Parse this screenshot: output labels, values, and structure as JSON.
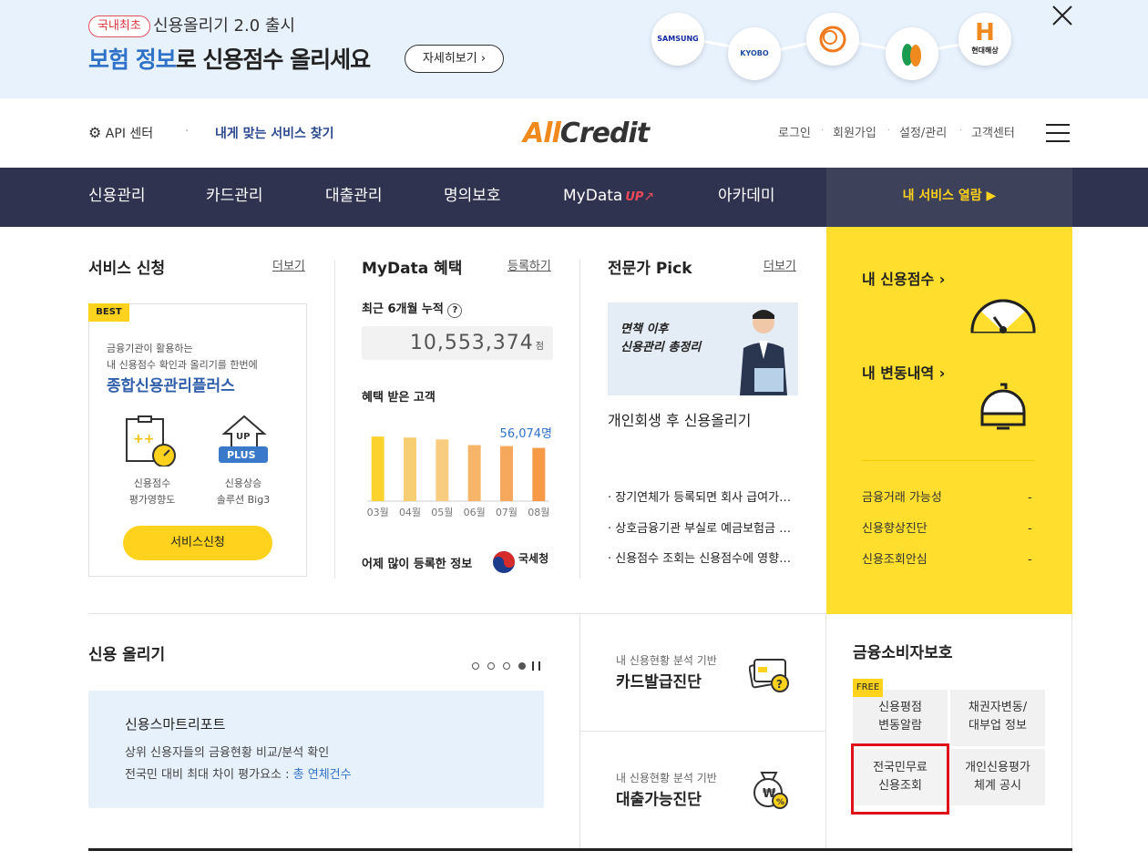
{
  "banner": {
    "badge": "국내최초",
    "subtitle": "신용올리기 2.0 출시",
    "title_highlight": "보험 정보",
    "title_rest": "로 신용점수 올리세요",
    "detail_button": "자세히보기 ›",
    "partners": [
      "SAMSUNG",
      "KYOBO",
      "",
      "",
      "현대해상"
    ],
    "close_icon": "close-icon"
  },
  "header": {
    "api_center": "API 센터",
    "find_service": "내게 맞는 서비스 찾기",
    "logo_a": "All",
    "logo_b": "Credit",
    "utils": [
      "로그인",
      "회원가입",
      "설정/관리",
      "고객센터"
    ]
  },
  "nav": {
    "items": [
      "신용관리",
      "카드관리",
      "대출관리",
      "명의보호",
      "MyData",
      "아카데미"
    ],
    "mydata_up": "UP",
    "my_service": "내 서비스 열람 ▶"
  },
  "service": {
    "title": "서비스 신청",
    "more": "더보기",
    "best": "BEST",
    "desc1": "금융기관이 활용하는",
    "desc2": "내 신용점수 확인과 올리기를 한번에",
    "product": "종합신용관리플러스",
    "icon1_label1": "신용점수",
    "icon1_label2": "평가영향도",
    "icon2_label1": "신용상승",
    "icon2_label2": "솔루션 Big3",
    "icon2_up": "UP",
    "icon2_plus": "PLUS",
    "button": "서비스신청"
  },
  "mydata": {
    "title": "MyData 혜택",
    "register": "등록하기",
    "cumulative_label": "최근 6개월 누적",
    "cumulative_value": "10,553,374",
    "cumulative_unit": "점",
    "customers_label": "혜택 받은 고객",
    "latest_value": "56,074명",
    "most_registered": "어제 많이 등록한 정보",
    "nts_label": "국세청"
  },
  "chart_data": {
    "type": "bar",
    "categories": [
      "03월",
      "04월",
      "05월",
      "06월",
      "07월",
      "08월"
    ],
    "values": [
      68000,
      67000,
      65000,
      59000,
      58000,
      56074
    ],
    "colors": [
      "#fcd22f",
      "#f7cf72",
      "#f8cd80",
      "#f6b569",
      "#f6a95d",
      "#f69a48"
    ],
    "ylim": [
      0,
      72000
    ]
  },
  "expert": {
    "title": "전문가 Pick",
    "more": "더보기",
    "thumb_line1": "면책 이후",
    "thumb_line2": "신용관리 총정리",
    "headline": "개인회생 후 신용올리기",
    "list": [
      "장기연체가 등록되면 회사 급여가…",
      "상호금융기관 부실로 예금보험금 …",
      "신용점수 조회는 신용점수에 영향…"
    ]
  },
  "yellow": {
    "score_link": "내 신용점수 ›",
    "change_link": "내 변동내역 ›",
    "rows": [
      "금융거래 가능성",
      "신용향상진단",
      "신용조회안심"
    ],
    "dash": "-"
  },
  "boost": {
    "title": "신용 올리기",
    "card_title": "신용스마트리포트",
    "line1": "상위 신용자들의 금융현황 비교/분석 확인",
    "line2_prefix": "전국민 대비 최대 차이 평가요소 : ",
    "line2_link": "총 연체건수"
  },
  "diag": {
    "card_sub": "내 신용현황 분석 기반",
    "card_title": "카드발급진단",
    "loan_sub": "내 신용현황 분석 기반",
    "loan_title": "대출가능진단"
  },
  "consumer": {
    "title": "금융소비자보호",
    "free": "FREE",
    "cells": [
      [
        "신용평점",
        "변동알람"
      ],
      [
        "채권자변동/",
        "대부업 정보"
      ],
      [
        "전국민무료",
        "신용조회"
      ],
      [
        "개인신용평가",
        "체계 공시"
      ]
    ]
  },
  "colors": {
    "nav_bg": "#2f3350",
    "accent_yellow": "#ffde2e",
    "brand_orange": "#f08a1f",
    "link_blue": "#2f72c8",
    "highlight_red": "#e0101a"
  }
}
